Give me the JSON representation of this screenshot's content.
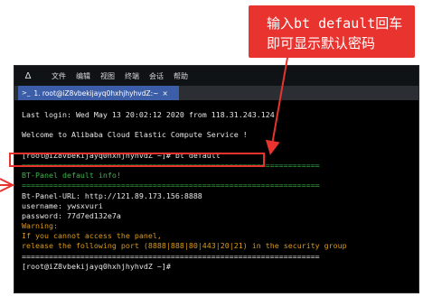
{
  "callout": {
    "line1": "输入bt default回车",
    "line2": "即可显示默认密码",
    "color": "#e8332f"
  },
  "menubar": {
    "logo": "Δ",
    "items": [
      "文件",
      "编辑",
      "视图",
      "终端",
      "会话",
      "帮助"
    ]
  },
  "tab": {
    "icon": ">_",
    "label": "1. root@iZ8vbekijayq0hxhjhyhvdZ:~",
    "close": "×"
  },
  "terminal": {
    "lines": [
      {
        "text": "Last login: Wed May 13 20:02:12 2020 from 118.31.243.124",
        "tone": "white"
      },
      {
        "text": "",
        "tone": "white"
      },
      {
        "text": "Welcome to Alibaba Cloud Elastic Compute Service !",
        "tone": "white"
      },
      {
        "text": "",
        "tone": "white"
      },
      {
        "text": "[root@iZ8vbekijayq0hxhjhyhvdZ ~]# bt default",
        "tone": "white"
      },
      {
        "text": "==================================================================",
        "tone": "green"
      },
      {
        "text": "BT-Panel default info!",
        "tone": "green"
      },
      {
        "text": "==================================================================",
        "tone": "green"
      },
      {
        "text": "Bt-Panel-URL: http://121.89.173.156:8888",
        "tone": "white"
      },
      {
        "text": "username: ywsxvuri",
        "tone": "white"
      },
      {
        "text": "password: 77d7ed132e7a",
        "tone": "white"
      },
      {
        "text": "Warning:",
        "tone": "orange"
      },
      {
        "text": "If you cannot access the panel,",
        "tone": "orange"
      },
      {
        "text": "release the following port (8888|888|80|443|20|21) in the security group",
        "tone": "orange"
      },
      {
        "text": "==================================================================",
        "tone": "white"
      },
      {
        "text": "[root@iZ8vbekijayq0hxhjhyhvdZ ~]#",
        "tone": "white"
      }
    ]
  }
}
